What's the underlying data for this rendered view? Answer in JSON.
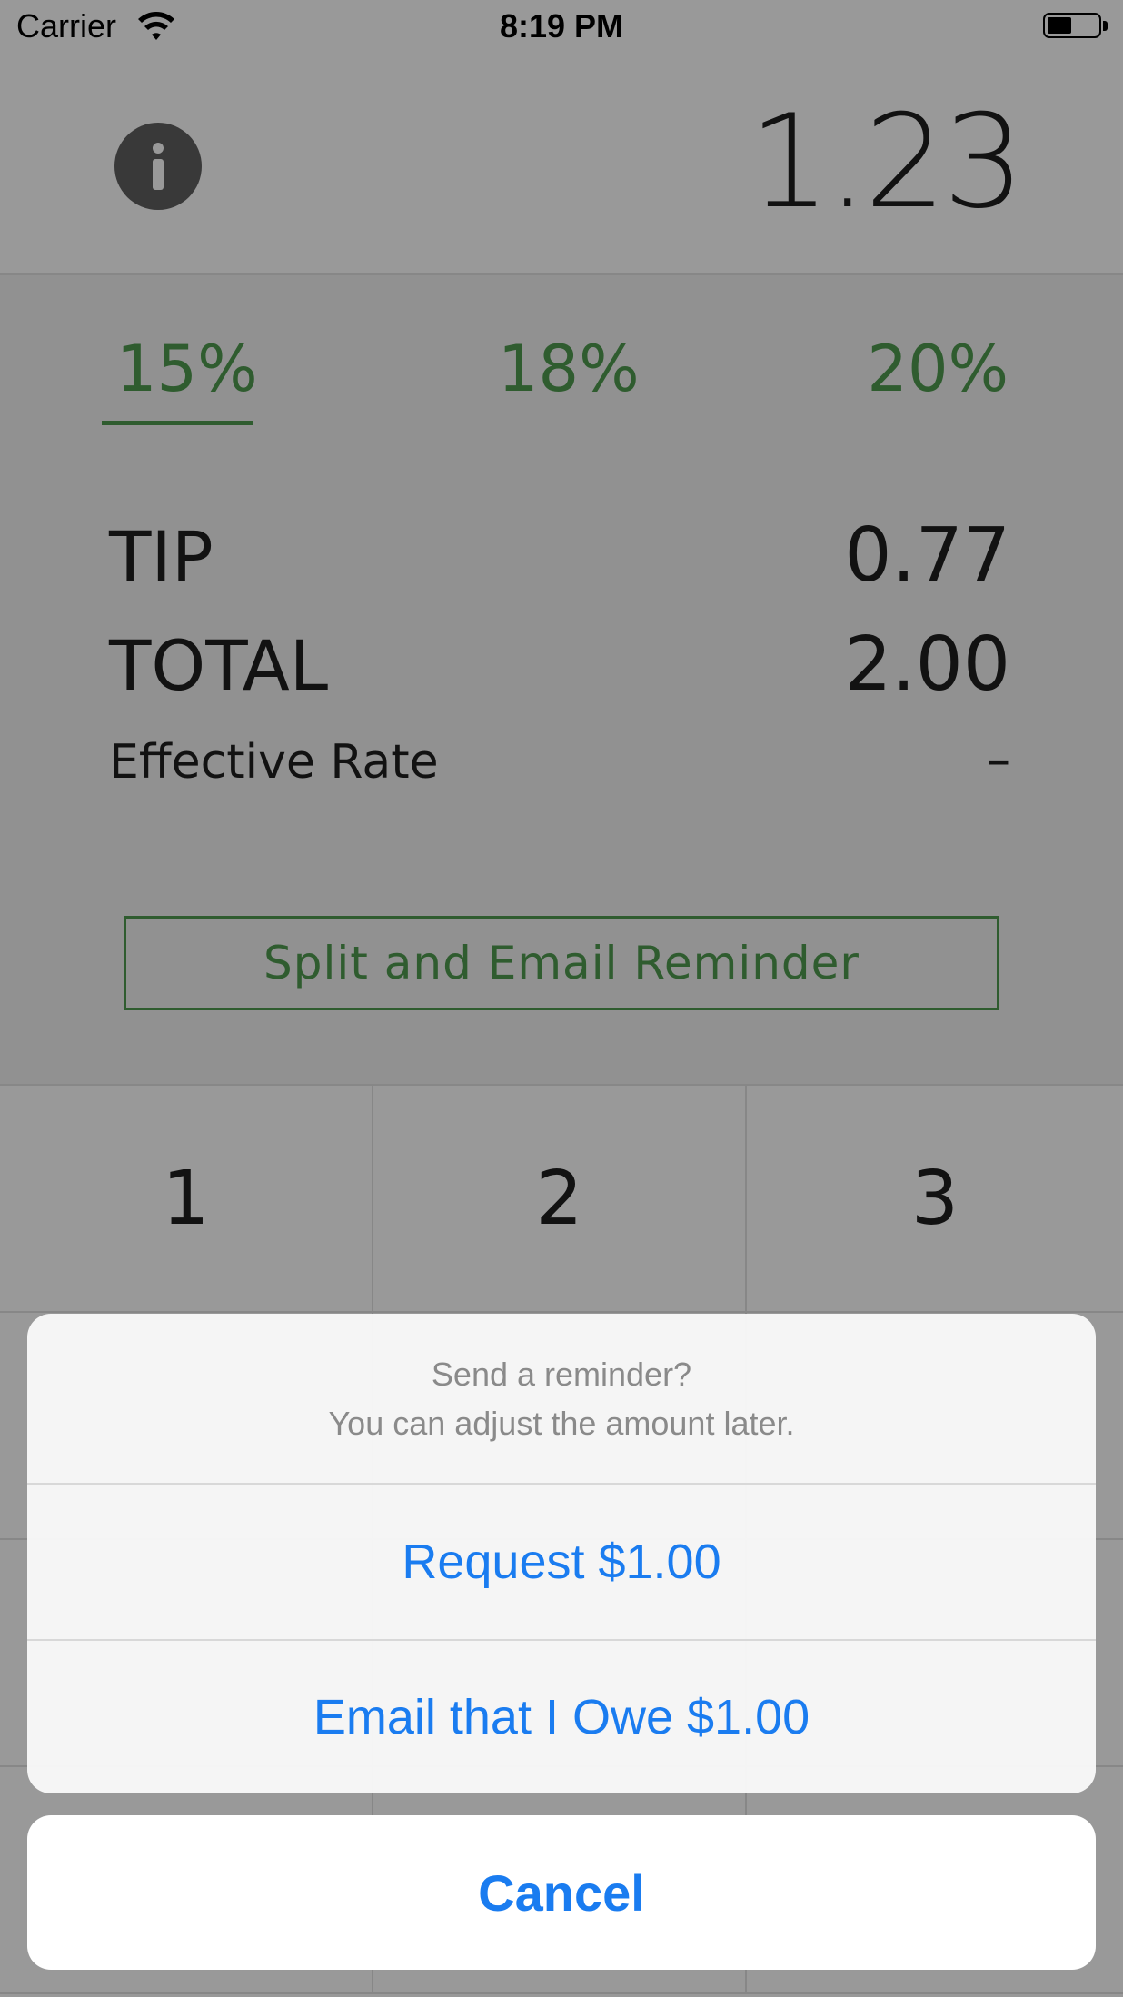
{
  "status_bar": {
    "carrier": "Carrier",
    "time": "8:19 PM",
    "wifi_icon": "wifi-icon",
    "battery_icon": "battery-icon"
  },
  "header": {
    "info_icon": "info-icon",
    "bill_amount": "1.23"
  },
  "tip_tabs": [
    {
      "label": "15%",
      "selected": true
    },
    {
      "label": "18%",
      "selected": false
    },
    {
      "label": "20%",
      "selected": false
    }
  ],
  "summary": {
    "tip_label": "TIP",
    "tip_value": "0.77",
    "total_label": "TOTAL",
    "total_value": "2.00",
    "rate_label": "Effective Rate",
    "rate_value": "–"
  },
  "split_button": {
    "label": "Split and Email Reminder"
  },
  "keypad": {
    "keys": [
      "1",
      "2",
      "3"
    ]
  },
  "action_sheet": {
    "title": "Send a reminder?",
    "message": "You can adjust the amount later.",
    "actions": [
      {
        "label": "Request $1.00"
      },
      {
        "label": "Email that I Owe $1.00"
      }
    ],
    "cancel_label": "Cancel"
  },
  "colors": {
    "accent_green": "#4f9a4f",
    "ios_blue": "#1a7cf0"
  }
}
